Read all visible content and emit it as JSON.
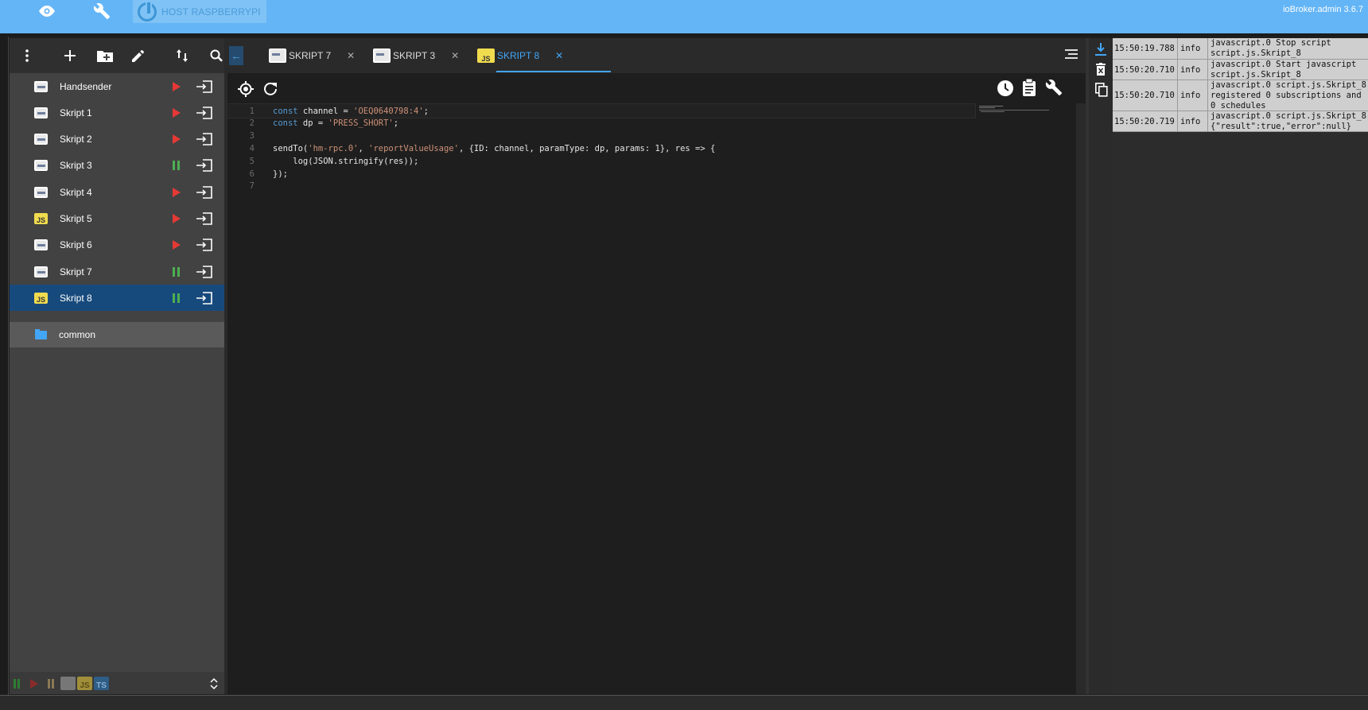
{
  "app": {
    "host_label": "HOST RASPBERRYPI",
    "admin_version": "ioBroker.admin 3.6.7"
  },
  "sidebar": {
    "scripts": [
      {
        "name": "Handsender",
        "type": "blockly",
        "state": "stopped",
        "selected": false
      },
      {
        "name": "Skript 1",
        "type": "blockly",
        "state": "stopped",
        "selected": false
      },
      {
        "name": "Skript 2",
        "type": "blockly",
        "state": "stopped",
        "selected": false
      },
      {
        "name": "Skript 3",
        "type": "blockly",
        "state": "running",
        "selected": false
      },
      {
        "name": "Skript 4",
        "type": "blockly",
        "state": "stopped",
        "selected": false
      },
      {
        "name": "Skript 5",
        "type": "js",
        "state": "stopped",
        "selected": false
      },
      {
        "name": "Skript 6",
        "type": "blockly",
        "state": "stopped",
        "selected": false
      },
      {
        "name": "Skript 7",
        "type": "blockly",
        "state": "running",
        "selected": false
      },
      {
        "name": "Skript 8",
        "type": "js",
        "state": "running",
        "selected": true
      }
    ],
    "folder": "common",
    "footer_labels": {
      "js": "JS",
      "ts": "TS"
    }
  },
  "tabs": [
    {
      "label": "SKRIPT 7",
      "type": "blockly",
      "active": false
    },
    {
      "label": "SKRIPT 3",
      "type": "blockly",
      "active": false
    },
    {
      "label": "SKRIPT 8",
      "type": "js",
      "active": true
    }
  ],
  "editor": {
    "lines": [
      {
        "num": "1",
        "code": "const channel = 'OEQ0640798:4';"
      },
      {
        "num": "2",
        "code": "const dp = 'PRESS_SHORT';"
      },
      {
        "num": "3",
        "code": ""
      },
      {
        "num": "4",
        "code": "sendTo('hm-rpc.0', 'reportValueUsage', {ID: channel, paramType: dp, params: 1}, res => {"
      },
      {
        "num": "5",
        "code": "    log(JSON.stringify(res));"
      },
      {
        "num": "6",
        "code": "});"
      },
      {
        "num": "7",
        "code": ""
      }
    ]
  },
  "log": {
    "entries": [
      {
        "time": "15:50:19.788",
        "level": "info",
        "message": "javascript.0 Stop script script.js.Skript_8"
      },
      {
        "time": "15:50:20.710",
        "level": "info",
        "message": "javascript.0 Start javascript script.js.Skript_8"
      },
      {
        "time": "15:50:20.710",
        "level": "info",
        "message": "javascript.0 script.js.Skript_8 registered 0 subscriptions and 0 schedules"
      },
      {
        "time": "15:50:20.719",
        "level": "info",
        "message": "javascript.0 script.js.Skript_8 {\"result\":true,\"error\":null}"
      }
    ]
  },
  "colors": {
    "accent": "#42a5f5",
    "topbar": "#64b5f6",
    "run_green": "#4caf50",
    "stop_red": "#e53935",
    "selected_row": "#174a7c"
  }
}
